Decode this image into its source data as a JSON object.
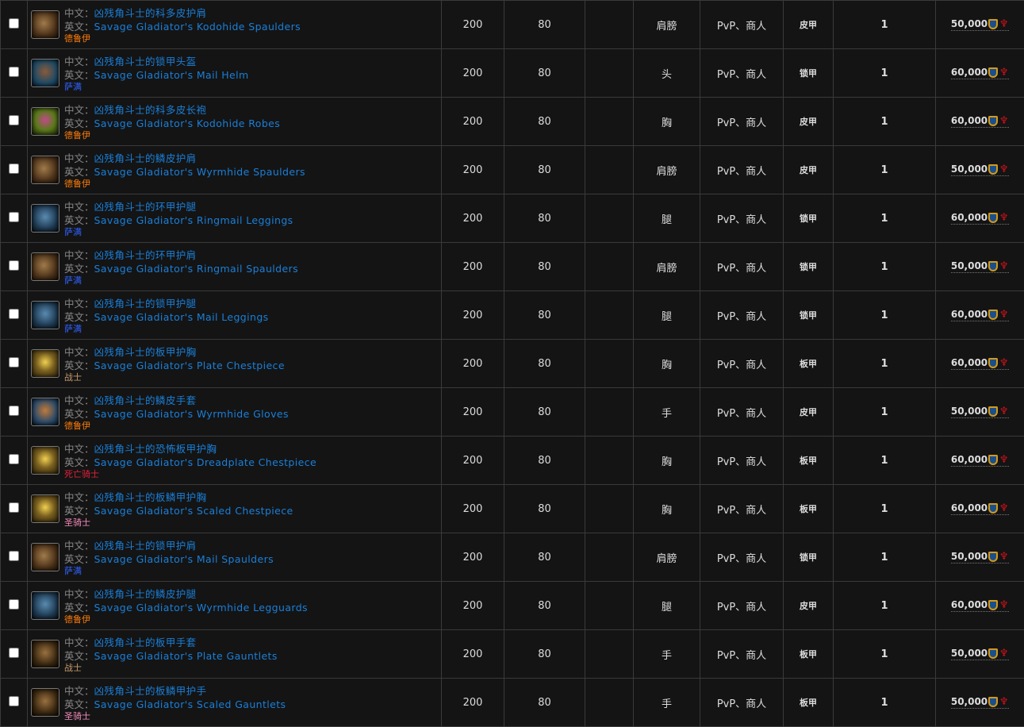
{
  "labels": {
    "cn": "中文：",
    "en": "英文："
  },
  "class_colors": {
    "德鲁伊": "#ff7d0a",
    "萨满": "#2f62ff",
    "战士": "#c79c6e",
    "死亡骑士": "#e0213b",
    "圣骑士": "#f58cba"
  },
  "rows": [
    {
      "cn": "凶残角斗士的科多皮护肩",
      "en": "Savage Gladiator's Kodohide Spaulders",
      "cls": "德鲁伊",
      "icon": "spaulders-icon",
      "c1": "200",
      "c2": "80",
      "c3": "",
      "slot": "肩膀",
      "source": "PvP、商人",
      "type": "皮甲",
      "qty": "1",
      "price": "50,000"
    },
    {
      "cn": "凶残角斗士的锁甲头盔",
      "en": "Savage Gladiator's Mail Helm",
      "cls": "萨满",
      "icon": "helm-icon",
      "c1": "200",
      "c2": "80",
      "c3": "",
      "slot": "头",
      "source": "PvP、商人",
      "type": "锁甲",
      "qty": "1",
      "price": "60,000"
    },
    {
      "cn": "凶残角斗士的科多皮长袍",
      "en": "Savage Gladiator's Kodohide Robes",
      "cls": "德鲁伊",
      "icon": "robe-icon",
      "c1": "200",
      "c2": "80",
      "c3": "",
      "slot": "胸",
      "source": "PvP、商人",
      "type": "皮甲",
      "qty": "1",
      "price": "60,000"
    },
    {
      "cn": "凶残角斗士的鳞皮护肩",
      "en": "Savage Gladiator's Wyrmhide Spaulders",
      "cls": "德鲁伊",
      "icon": "spaulders-icon",
      "c1": "200",
      "c2": "80",
      "c3": "",
      "slot": "肩膀",
      "source": "PvP、商人",
      "type": "皮甲",
      "qty": "1",
      "price": "50,000"
    },
    {
      "cn": "凶残角斗士的环甲护腿",
      "en": "Savage Gladiator's Ringmail Leggings",
      "cls": "萨满",
      "icon": "leggings-icon",
      "c1": "200",
      "c2": "80",
      "c3": "",
      "slot": "腿",
      "source": "PvP、商人",
      "type": "锁甲",
      "qty": "1",
      "price": "60,000"
    },
    {
      "cn": "凶残角斗士的环甲护肩",
      "en": "Savage Gladiator's Ringmail Spaulders",
      "cls": "萨满",
      "icon": "spaulders-icon",
      "c1": "200",
      "c2": "80",
      "c3": "",
      "slot": "肩膀",
      "source": "PvP、商人",
      "type": "锁甲",
      "qty": "1",
      "price": "50,000"
    },
    {
      "cn": "凶残角斗士的锁甲护腿",
      "en": "Savage Gladiator's Mail Leggings",
      "cls": "萨满",
      "icon": "leggings-icon",
      "c1": "200",
      "c2": "80",
      "c3": "",
      "slot": "腿",
      "source": "PvP、商人",
      "type": "锁甲",
      "qty": "1",
      "price": "60,000"
    },
    {
      "cn": "凶残角斗士的板甲护胸",
      "en": "Savage Gladiator's Plate Chestpiece",
      "cls": "战士",
      "icon": "chestpiece-icon",
      "c1": "200",
      "c2": "80",
      "c3": "",
      "slot": "胸",
      "source": "PvP、商人",
      "type": "板甲",
      "qty": "1",
      "price": "60,000"
    },
    {
      "cn": "凶残角斗士的鳞皮手套",
      "en": "Savage Gladiator's Wyrmhide Gloves",
      "cls": "德鲁伊",
      "icon": "gloves-icon",
      "c1": "200",
      "c2": "80",
      "c3": "",
      "slot": "手",
      "source": "PvP、商人",
      "type": "皮甲",
      "qty": "1",
      "price": "50,000"
    },
    {
      "cn": "凶残角斗士的恐怖板甲护胸",
      "en": "Savage Gladiator's Dreadplate Chestpiece",
      "cls": "死亡骑士",
      "icon": "chestpiece-icon",
      "c1": "200",
      "c2": "80",
      "c3": "",
      "slot": "胸",
      "source": "PvP、商人",
      "type": "板甲",
      "qty": "1",
      "price": "60,000"
    },
    {
      "cn": "凶残角斗士的板鳞甲护胸",
      "en": "Savage Gladiator's Scaled Chestpiece",
      "cls": "圣骑士",
      "icon": "chestpiece-icon",
      "c1": "200",
      "c2": "80",
      "c3": "",
      "slot": "胸",
      "source": "PvP、商人",
      "type": "板甲",
      "qty": "1",
      "price": "60,000"
    },
    {
      "cn": "凶残角斗士的锁甲护肩",
      "en": "Savage Gladiator's Mail Spaulders",
      "cls": "萨满",
      "icon": "spaulders-icon",
      "c1": "200",
      "c2": "80",
      "c3": "",
      "slot": "肩膀",
      "source": "PvP、商人",
      "type": "锁甲",
      "qty": "1",
      "price": "50,000"
    },
    {
      "cn": "凶残角斗士的鳞皮护腿",
      "en": "Savage Gladiator's Wyrmhide Legguards",
      "cls": "德鲁伊",
      "icon": "leggings-icon",
      "c1": "200",
      "c2": "80",
      "c3": "",
      "slot": "腿",
      "source": "PvP、商人",
      "type": "皮甲",
      "qty": "1",
      "price": "60,000"
    },
    {
      "cn": "凶残角斗士的板甲手套",
      "en": "Savage Gladiator's Plate Gauntlets",
      "cls": "战士",
      "icon": "gauntlets-icon",
      "c1": "200",
      "c2": "80",
      "c3": "",
      "slot": "手",
      "source": "PvP、商人",
      "type": "板甲",
      "qty": "1",
      "price": "50,000"
    },
    {
      "cn": "凶残角斗士的板鳞甲护手",
      "en": "Savage Gladiator's Scaled Gauntlets",
      "cls": "圣骑士",
      "icon": "gauntlets-icon",
      "c1": "200",
      "c2": "80",
      "c3": "",
      "slot": "手",
      "source": "PvP、商人",
      "type": "板甲",
      "qty": "1",
      "price": "50,000"
    }
  ]
}
